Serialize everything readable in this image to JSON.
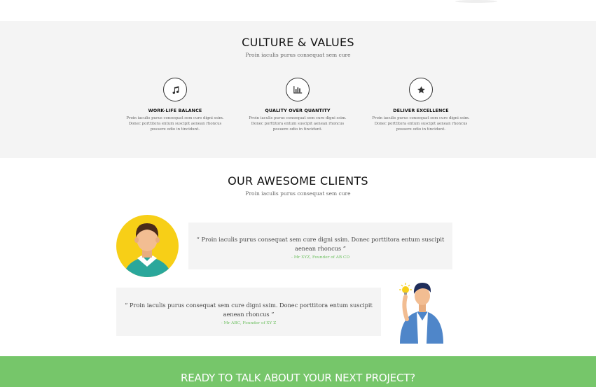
{
  "culture": {
    "title": "CULTURE & VALUES",
    "subtitle": "Proin iaculis purus consequat sem cure",
    "items": [
      {
        "icon": "music-note-icon",
        "title": "WORK-LIFE BALANCE",
        "text": "Proin iaculis purus consequat sem cure digni ssim. Donec porttitora entum suscipit aenean rhoncus posuere odio in tincidunt."
      },
      {
        "icon": "bar-chart-icon",
        "title": "QUALITY OVER QUANTITY",
        "text": "Proin iaculis purus consequat sem cure digni ssim. Donec porttitora entum suscipit aenean rhoncus posuere odio in tincidunt."
      },
      {
        "icon": "star-icon",
        "title": "DELIVER EXCELLENCE",
        "text": "Proin iaculis purus consequat sem cure digni ssim. Donec porttitora entum suscipit aenean rhoncus posuere odio in tincidunt."
      }
    ]
  },
  "clients": {
    "title": "OUR AWESOME CLIENTS",
    "subtitle": "Proin iaculis purus consequat sem cure",
    "testimonials": [
      {
        "quote": "“ Proin iaculis purus consequat sem cure digni ssim. Donec porttitora entum suscipit aenean rhoncus ”",
        "author": "- Mr XYZ, Founder of AB CD"
      },
      {
        "quote": "“ Proin iaculis purus consequat sem cure digni ssim. Donec porttitora entum suscipit aenean rhoncus ”",
        "author": "- Mr ABC, Founder of XY Z"
      }
    ]
  },
  "cta": {
    "title": "READY TO TALK ABOUT YOUR NEXT PROJECT?"
  },
  "colors": {
    "accent_green": "#76c66a",
    "section_gray": "#f4f4f4",
    "avatar_yellow": "#f7cf17"
  }
}
